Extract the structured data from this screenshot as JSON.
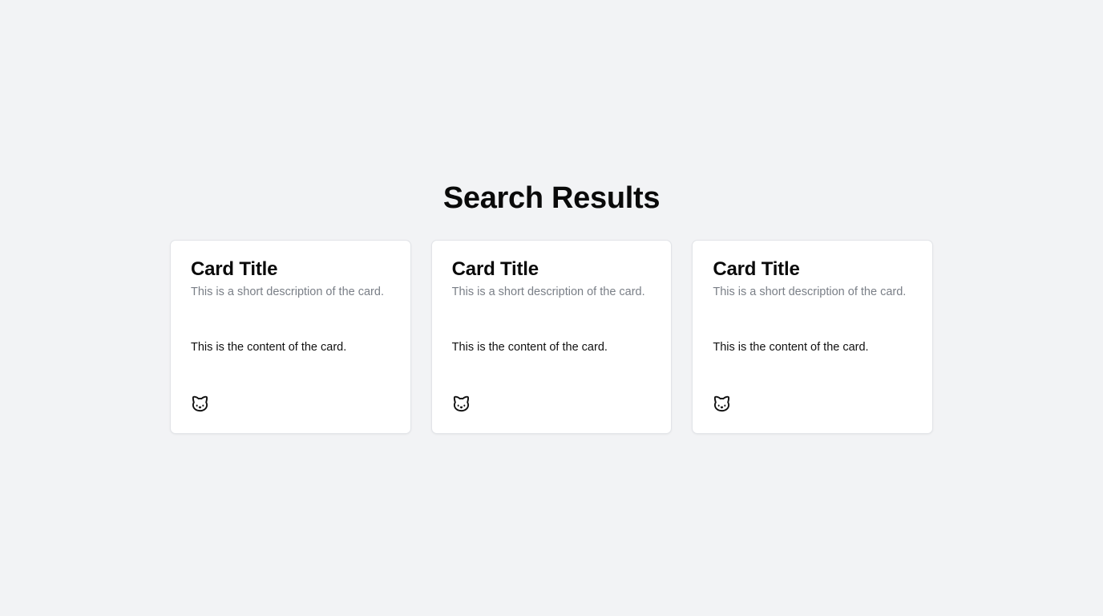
{
  "page": {
    "title": "Search Results"
  },
  "cards": [
    {
      "title": "Card Title",
      "description": "This is a short description of the card.",
      "content": "This is the content of the card.",
      "icon": "cat-icon"
    },
    {
      "title": "Card Title",
      "description": "This is a short description of the card.",
      "content": "This is the content of the card.",
      "icon": "cat-icon"
    },
    {
      "title": "Card Title",
      "description": "This is a short description of the card.",
      "content": "This is the content of the card.",
      "icon": "cat-icon"
    }
  ],
  "colors": {
    "background": "#f2f3f5",
    "card": "#ffffff",
    "description": "#7a7f87",
    "text": "#111111"
  }
}
